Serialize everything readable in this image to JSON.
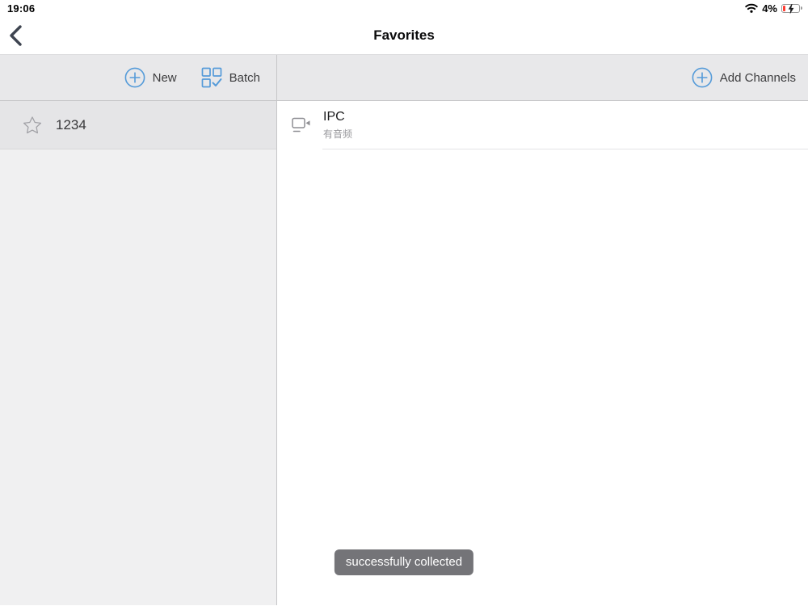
{
  "status_bar": {
    "time": "19:06",
    "battery_percent": "4%"
  },
  "nav": {
    "title": "Favorites"
  },
  "toolbar": {
    "new_label": "New",
    "batch_label": "Batch",
    "add_channels_label": "Add Channels"
  },
  "sidebar": {
    "items": [
      {
        "label": "1234"
      }
    ]
  },
  "channel_list": {
    "items": [
      {
        "title": "IPC",
        "subtitle": "有音频"
      }
    ]
  },
  "toast": {
    "message": "successfully collected"
  },
  "colors": {
    "accent_blue": "#559bd9",
    "icon_gray": "#8e8e93",
    "toast_bg": "#747478",
    "battery_red": "#ff3b30",
    "toolbar_bg": "#e8e8ea",
    "sidebar_bg": "#f0f0f1",
    "selected_row_bg": "#e5e5e7"
  }
}
